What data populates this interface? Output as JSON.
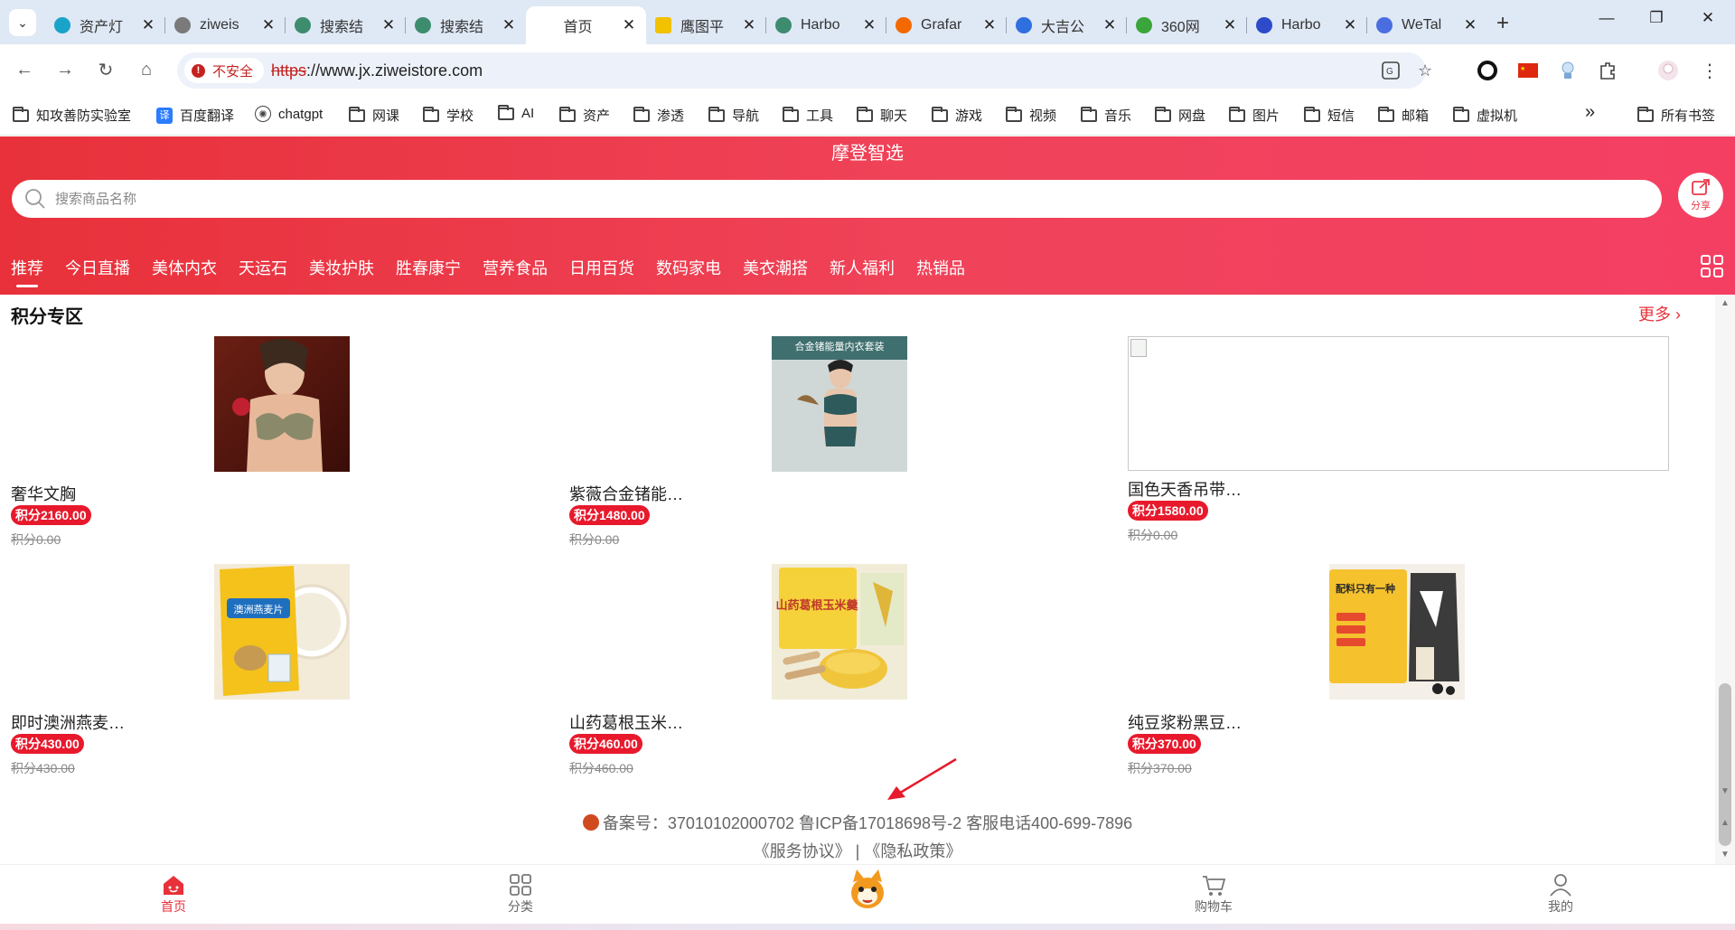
{
  "browser": {
    "tabs": [
      {
        "title": "资产灯",
        "favicon_color": "#1aa3c9"
      },
      {
        "title": "ziweis",
        "favicon_color": "#7a7a7a"
      },
      {
        "title": "搜索结",
        "favicon_color": "#3d8c6e"
      },
      {
        "title": "搜索结",
        "favicon_color": "#3d8c6e"
      },
      {
        "title": "首页",
        "favicon_color": "",
        "active": true
      },
      {
        "title": "鹰图平",
        "favicon_color": "#f2c100"
      },
      {
        "title": "Harbo",
        "favicon_color": "#3d8c6e"
      },
      {
        "title": "Grafar",
        "favicon_color": "#f46800"
      },
      {
        "title": "大吉公",
        "favicon_color": "#2f6fe0"
      },
      {
        "title": "360网",
        "favicon_color": "#3aa53a"
      },
      {
        "title": "Harbo",
        "favicon_color": "#2d4ac9"
      },
      {
        "title": "WeTal",
        "favicon_color": "#4a6ee0"
      }
    ],
    "close_glyph": "✕",
    "new_tab_glyph": "+",
    "address": {
      "security_label": "不安全",
      "protocol": "https",
      "rest": "://www.jx.ziweistore.com"
    },
    "bookmarks": [
      {
        "label": "知攻善防实验室",
        "type": "site",
        "color": "#111"
      },
      {
        "label": "百度翻译",
        "type": "site",
        "color": "#2b7cff"
      },
      {
        "label": "chatgpt",
        "type": "site",
        "color": "#444"
      },
      {
        "label": "网课",
        "type": "folder"
      },
      {
        "label": "学校",
        "type": "folder"
      },
      {
        "label": "AI",
        "type": "folder"
      },
      {
        "label": "资产",
        "type": "folder"
      },
      {
        "label": "渗透",
        "type": "folder"
      },
      {
        "label": "导航",
        "type": "folder"
      },
      {
        "label": "工具",
        "type": "folder"
      },
      {
        "label": "聊天",
        "type": "folder"
      },
      {
        "label": "游戏",
        "type": "folder"
      },
      {
        "label": "视频",
        "type": "folder"
      },
      {
        "label": "音乐",
        "type": "folder"
      },
      {
        "label": "网盘",
        "type": "folder"
      },
      {
        "label": "图片",
        "type": "folder"
      },
      {
        "label": "短信",
        "type": "folder"
      },
      {
        "label": "邮箱",
        "type": "folder"
      },
      {
        "label": "虚拟机",
        "type": "folder"
      }
    ],
    "overflow_glyph": "»",
    "all_bookmarks": "所有书签"
  },
  "page": {
    "title": "摩登智选",
    "search_placeholder": "搜索商品名称",
    "share_label": "分享",
    "categories": [
      "推荐",
      "今日直播",
      "美体内衣",
      "天运石",
      "美妆护肤",
      "胜春康宁",
      "营养食品",
      "日用百货",
      "数码家电",
      "美衣潮搭",
      "新人福利",
      "热销品"
    ],
    "section_title": "积分专区",
    "more_label": "更多",
    "products": [
      {
        "name": "奢华文胸",
        "price": "积分2160.00",
        "original": "积分0.00",
        "image": "lingerie-photo"
      },
      {
        "name": "紫薇合金锗能…",
        "price": "积分1480.00",
        "original": "积分0.00",
        "image": "lingerie-set-photo",
        "image_banner": "合金锗能量内衣套装"
      },
      {
        "name": "国色天香吊带…",
        "price": "积分1580.00",
        "original": "积分0.00",
        "image": "broken-image"
      },
      {
        "name": "即时澳洲燕麦…",
        "price": "积分430.00",
        "original": "积分430.00",
        "image": "oatmeal-package",
        "image_text": "澳洲燕麦片"
      },
      {
        "name": "山药葛根玉米…",
        "price": "积分460.00",
        "original": "积分460.00",
        "image": "yam-corn-soup",
        "image_text": "山药葛根玉米羹"
      },
      {
        "name": "纯豆浆粉黑豆…",
        "price": "积分370.00",
        "original": "积分370.00",
        "image": "soy-milk-powder",
        "image_text": "配料只有一种"
      }
    ],
    "footer": {
      "record": "备案号：37010102000702  鲁ICP备17018698号-2 客服电话400-699-7896",
      "links": "《服务协议》 | 《隐私政策》"
    },
    "bottom_nav": [
      {
        "label": "首页",
        "active": true
      },
      {
        "label": "分类"
      },
      {
        "label": "",
        "mascot": true
      },
      {
        "label": "购物车"
      },
      {
        "label": "我的"
      }
    ]
  },
  "colors": {
    "brand_red": "#e8313a",
    "price_badge": "#e8192c"
  }
}
